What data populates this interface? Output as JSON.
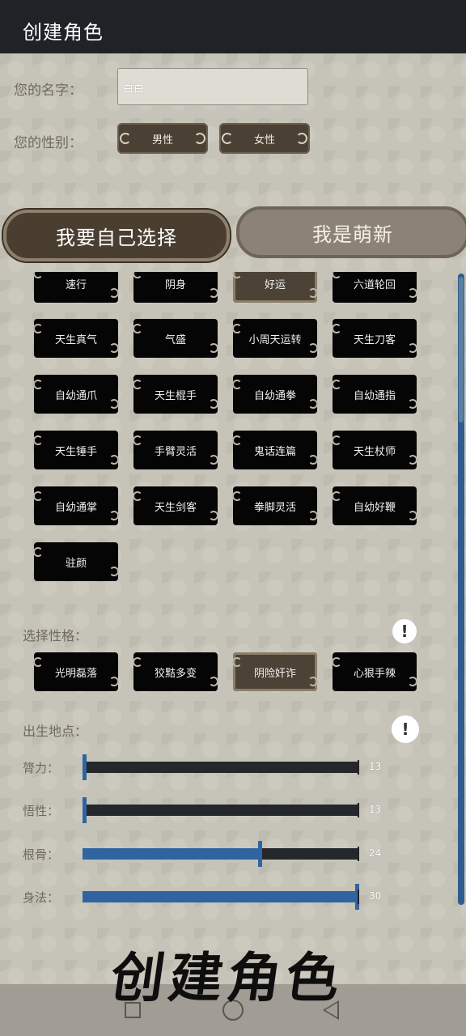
{
  "window": {
    "title": "创建角色"
  },
  "form": {
    "name_label": "您的名字：",
    "name_value": "白白",
    "gender_label": "您的性别：",
    "gender_options": [
      "男性",
      "女性"
    ]
  },
  "mode": {
    "self_select": "我要自己选择",
    "newbie": "我是萌新"
  },
  "traits": {
    "rows": [
      [
        "速行",
        "阴身",
        "好运",
        "六道轮回"
      ],
      [
        "天生真气",
        "气盛",
        "小周天运转",
        "天生刀客"
      ],
      [
        "自幼通爪",
        "天生棍手",
        "自幼通拳",
        "自幼通指"
      ],
      [
        "天生锤手",
        "手臂灵活",
        "鬼话连篇",
        "天生杖师"
      ],
      [
        "自幼通掌",
        "天生剑客",
        "拳脚灵活",
        "自幼好鞭"
      ],
      [
        "驻颜"
      ]
    ],
    "selected": "好运"
  },
  "personality": {
    "label": "选择性格：",
    "options": [
      "光明磊落",
      "狡黠多变",
      "阴险奸诈",
      "心狠手辣"
    ],
    "selected": "阴险奸诈"
  },
  "birthplace": {
    "label": "出生地点："
  },
  "stats": [
    {
      "label": "膂力：",
      "value": "13",
      "fraction": 0.0
    },
    {
      "label": "悟性：",
      "value": "13",
      "fraction": 0.0
    },
    {
      "label": "根骨：",
      "value": "24",
      "fraction": 0.64
    },
    {
      "label": "身法：",
      "value": "30",
      "fraction": 1.0
    }
  ],
  "footer": {
    "logo_text": "创建角色"
  },
  "colors": {
    "accent": "#2f64a0",
    "panel": "#4a4034",
    "tag": "#050505"
  },
  "icons": [
    "info-icon",
    "recents-icon",
    "home-icon",
    "back-icon"
  ]
}
